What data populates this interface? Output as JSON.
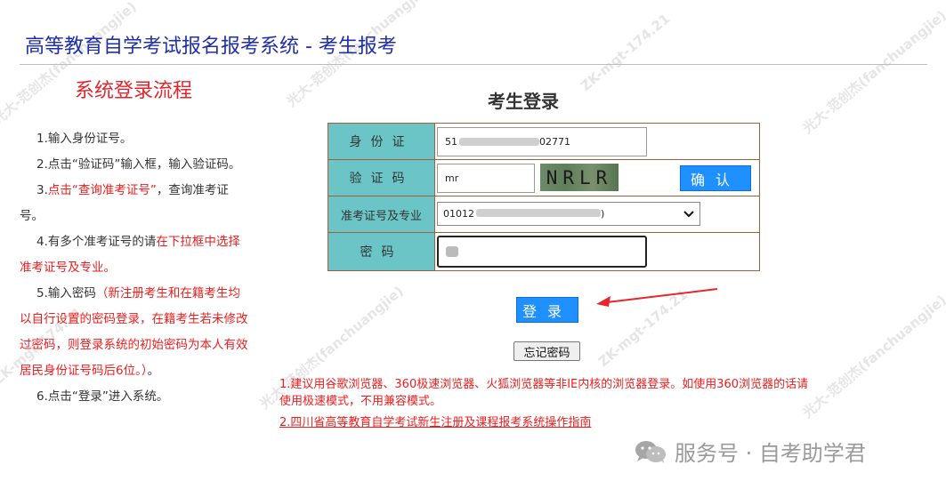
{
  "header": {
    "title": "高等教育自学考试报名报考系统 - 考生报考"
  },
  "flow": {
    "title": "系统登录流程",
    "step1": "1.输入身份证号。",
    "step2": "2.点击“验证码”输入框，输入验证码。",
    "step3_prefix": "3.",
    "step3_red": "点击“查询准考证号”",
    "step3_suffix": "，查询准考证号。",
    "step4_prefix": "4.有多个准考证号的请",
    "step4_red": "在下拉框中选择准考证号及专业。",
    "step5_prefix": "5.输入密码",
    "step5_red": "（新注册考生和在籍考生均以自行设置的密码登录，在籍考生若未修改过密码，则登录系统的初始密码为本人有效居民身份证号码后6位。）",
    "step5_suffix": "。",
    "step6": "6.点击“登录”进入系统。"
  },
  "login": {
    "title": "考生登录",
    "id_label": "身份证",
    "id_value_start": "51",
    "id_value_end": "02771",
    "captcha_label": "验证码",
    "captcha_value": "mr",
    "captcha_image_text": "NRLR",
    "confirm_label": "确认",
    "ticket_label": "准考证号及专业",
    "ticket_selected_start": "01012",
    "ticket_selected_end": ")",
    "password_label": "密码",
    "login_button": "登录",
    "forgot_button": "忘记密码"
  },
  "notes": {
    "note1": "1.建议用谷歌浏览器、360极速浏览器、火狐浏览器等非IE内核的浏览器登录。如使用360浏览器的话请使用极速模式，不用兼容模式。",
    "note2": "2.四川省高等教育自学考试新生注册及课程报考系统操作指南"
  },
  "brand": {
    "text": "服务号 · 自考助学君",
    "icon": "wechat-icon"
  },
  "watermark": {
    "line1": "光大-范创杰(fanchuangjie)",
    "line2": "ZK-mgt-174.21"
  },
  "colors": {
    "header": "#1f2fa8",
    "label_bg": "#6bc5c7",
    "button": "#1e90ff",
    "red": "#ee1d1d"
  }
}
